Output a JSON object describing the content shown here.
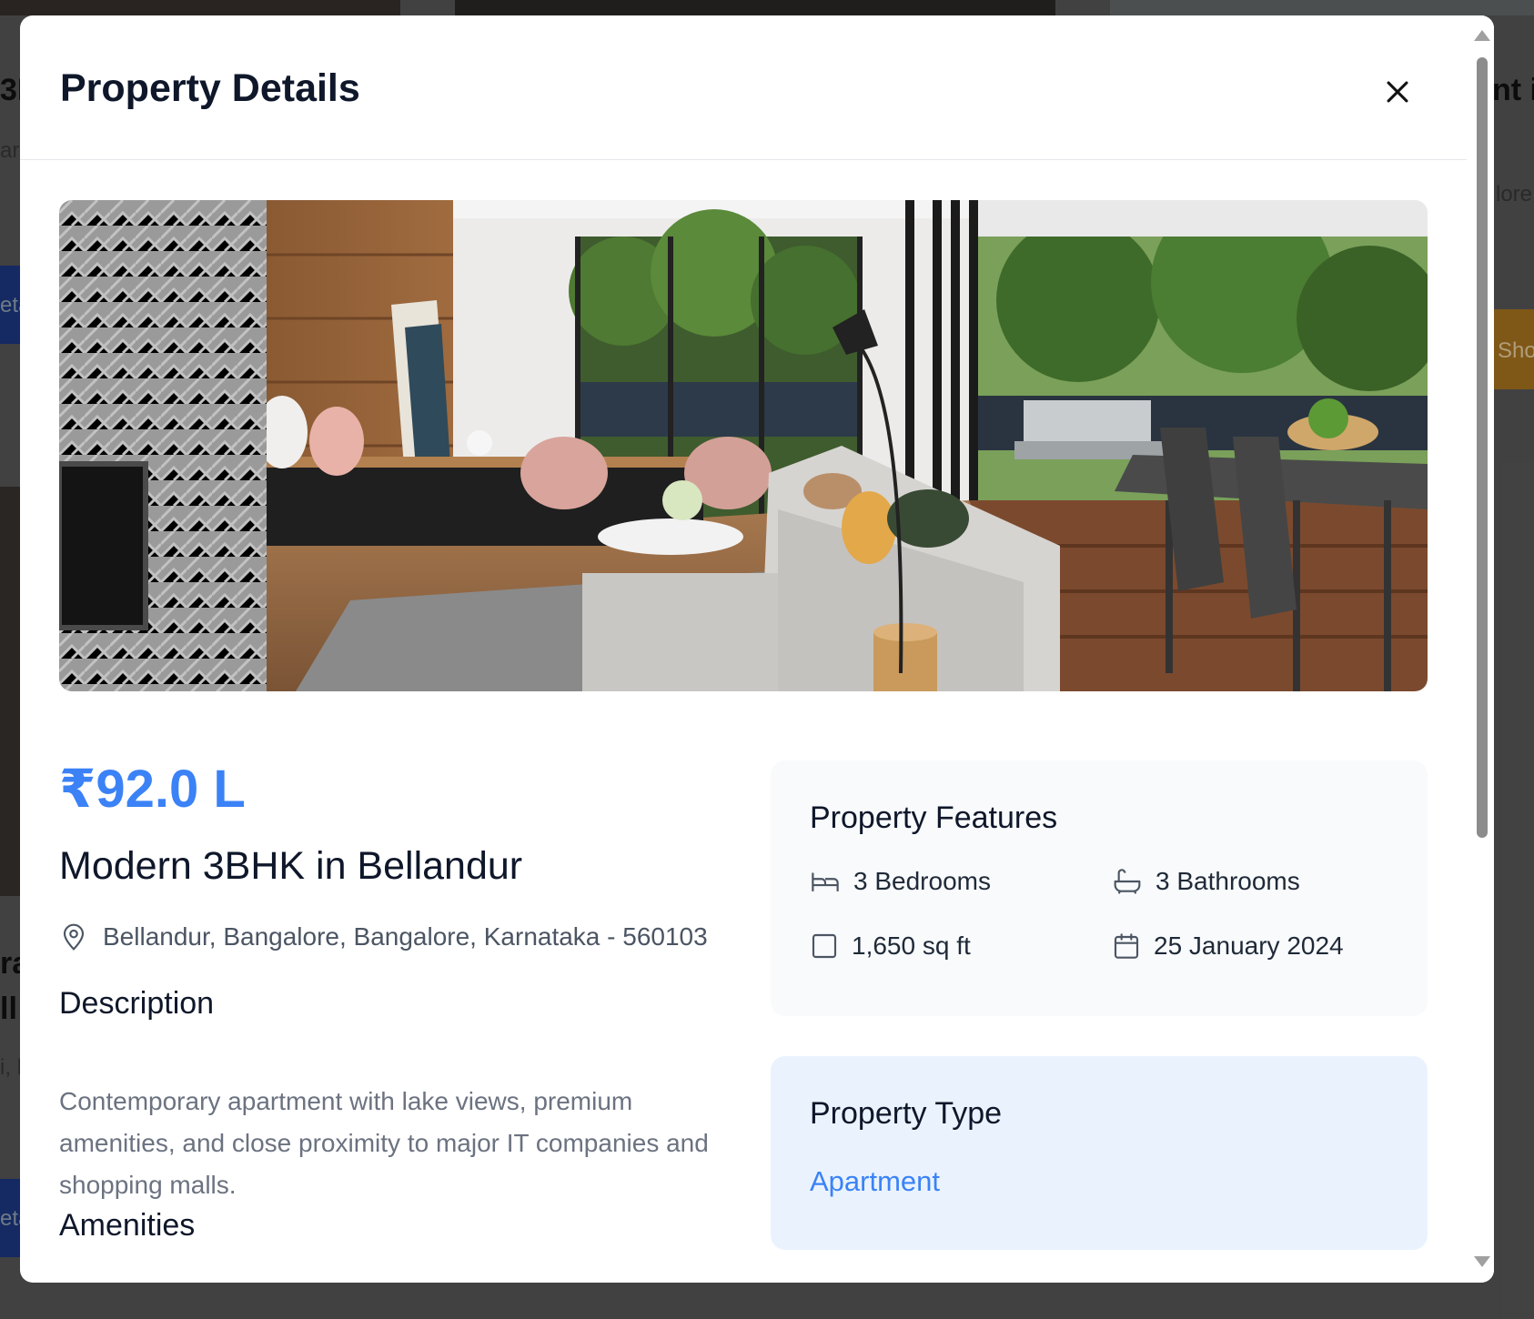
{
  "background": {
    "fragments": [
      "3H",
      "ar",
      "eta",
      "ra",
      "ll",
      "i, l",
      "eta",
      "nt i",
      "lore",
      "Sho"
    ]
  },
  "modal": {
    "title": "Property Details",
    "close_icon": "close-icon"
  },
  "property": {
    "price": "₹92.0 L",
    "title": "Modern 3BHK in Bellandur",
    "location": "Bellandur, Bangalore, Bangalore, Karnataka - 560103",
    "description_heading": "Description",
    "description": "Contemporary apartment with lake views, premium amenities, and close proximity to major IT companies and shopping malls.",
    "amenities_heading": "Amenities"
  },
  "features": {
    "heading": "Property Features",
    "bedrooms": "3 Bedrooms",
    "bathrooms": "3 Bathrooms",
    "area": "1,650 sq ft",
    "date": "25 January 2024"
  },
  "property_type": {
    "heading": "Property Type",
    "value": "Apartment"
  },
  "icons": {
    "location": "map-pin-icon",
    "bed": "bed-icon",
    "bath": "bath-icon",
    "area": "square-icon",
    "calendar": "calendar-icon"
  },
  "colors": {
    "accent": "#3b82f6",
    "features_card": "#f8fafc",
    "type_card": "#eaf3fd",
    "next_card": "#fdf6e3"
  }
}
